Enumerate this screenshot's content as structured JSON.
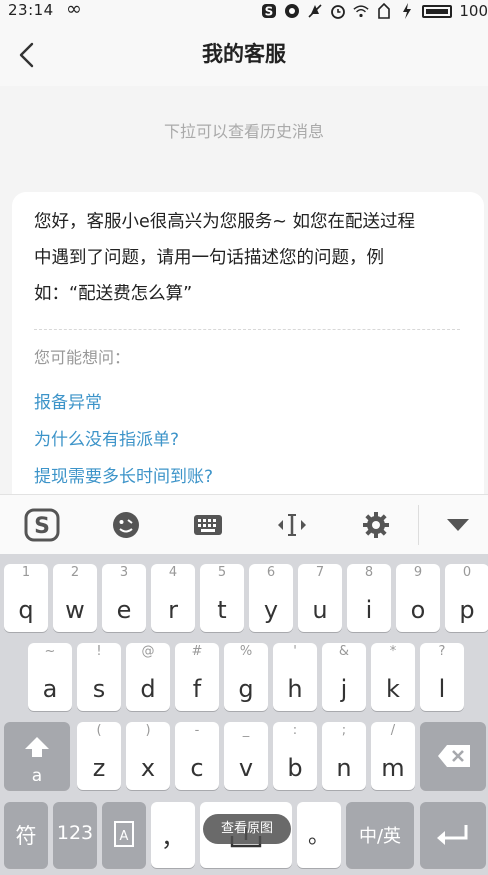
{
  "status_bar": {
    "time": "23:14",
    "battery": "100",
    "icons": [
      "infinity-icon",
      "sogou-s-icon",
      "eye-icon",
      "notification-off-icon",
      "alarm-icon",
      "wifi-icon",
      "sim-icon",
      "charging-icon",
      "battery-icon"
    ]
  },
  "header": {
    "title": "我的客服",
    "back_icon": "back-arrow-icon"
  },
  "chat": {
    "pull_hint": "下拉可以查看历史消息",
    "message_lines": [
      "您好，客服小e很高兴为您服务~ 如您在配送过程",
      "中遇到了问题，请用一句话描述您的问题，例",
      "如：“配送费怎么算”"
    ],
    "suggest_title": "您可能想问：",
    "suggestions": [
      "报备异常",
      "为什么没有指派单?",
      "提现需要多长时间到账?"
    ],
    "link_color": "#3d94c9"
  },
  "keyboard": {
    "toolbar_icons": [
      "sogou-logo-icon",
      "emoji-icon",
      "keyboard-icon",
      "cursor-move-icon",
      "settings-gear-icon",
      "collapse-keyboard-icon"
    ],
    "row1": [
      {
        "main": "q",
        "sub": "1"
      },
      {
        "main": "w",
        "sub": "2"
      },
      {
        "main": "e",
        "sub": "3"
      },
      {
        "main": "r",
        "sub": "4"
      },
      {
        "main": "t",
        "sub": "5"
      },
      {
        "main": "y",
        "sub": "6"
      },
      {
        "main": "u",
        "sub": "7"
      },
      {
        "main": "i",
        "sub": "8"
      },
      {
        "main": "o",
        "sub": "9"
      },
      {
        "main": "p",
        "sub": "0"
      }
    ],
    "row2": [
      {
        "main": "a",
        "sub": "~"
      },
      {
        "main": "s",
        "sub": "!"
      },
      {
        "main": "d",
        "sub": "@"
      },
      {
        "main": "f",
        "sub": "#"
      },
      {
        "main": "g",
        "sub": "%"
      },
      {
        "main": "h",
        "sub": "'"
      },
      {
        "main": "j",
        "sub": "&"
      },
      {
        "main": "k",
        "sub": "*"
      },
      {
        "main": "l",
        "sub": "?"
      }
    ],
    "row3": [
      {
        "main": "z",
        "sub": "("
      },
      {
        "main": "x",
        "sub": ")"
      },
      {
        "main": "c",
        "sub": "-"
      },
      {
        "main": "v",
        "sub": "_"
      },
      {
        "main": "b",
        "sub": ":"
      },
      {
        "main": "n",
        "sub": ";"
      },
      {
        "main": "m",
        "sub": "/"
      }
    ],
    "shift_label": "a",
    "symbols_label": "符",
    "numbers_label": "123",
    "comma_label": "，",
    "period_label": "。",
    "lang_label": "中/英",
    "toast": "查看原图"
  }
}
